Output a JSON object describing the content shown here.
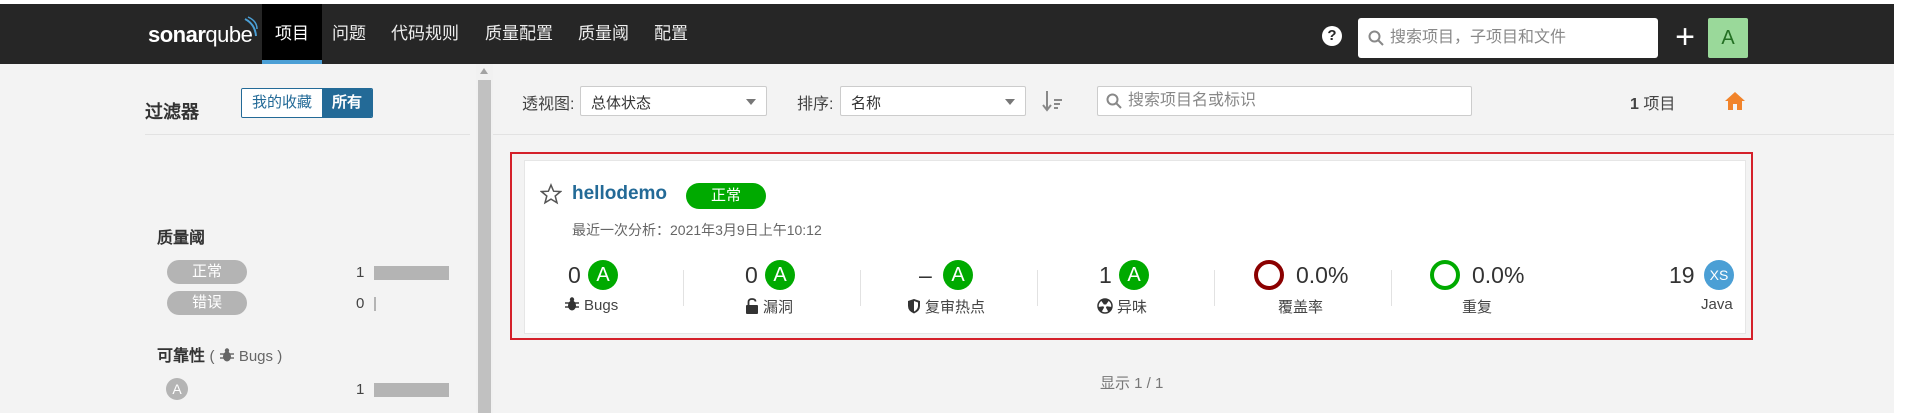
{
  "app": {
    "logo_main": "sonar",
    "logo_lite": "qube"
  },
  "nav": {
    "items": [
      "项目",
      "问题",
      "代码规则",
      "质量配置",
      "质量阈",
      "配置"
    ],
    "active": "项目",
    "search_placeholder": "搜索项目，子项目和文件",
    "help_label": "?",
    "add_label": "+",
    "avatar_letter": "A"
  },
  "sidebar": {
    "toggle": {
      "favorites": "我的收藏",
      "all": "所有"
    },
    "filter_title": "过滤器",
    "quality_gate": {
      "title": "质量阈",
      "items": [
        {
          "label": "正常",
          "count": "1",
          "fraction": 1.0
        },
        {
          "label": "错误",
          "count": "0",
          "fraction": 0.0
        }
      ]
    },
    "reliability": {
      "title": "可靠性",
      "paren_open": "(",
      "sub": "Bugs",
      "paren_close": ")",
      "items": [
        {
          "label": "A",
          "count": "1",
          "fraction": 1.0
        }
      ]
    }
  },
  "toolbar": {
    "perspective_label": "透视图:",
    "perspective_value": "总体状态",
    "sort_label": "排序:",
    "sort_value": "名称",
    "search_placeholder": "搜索项目名或标识",
    "project_count": "1",
    "project_count_suffix": "项目"
  },
  "project": {
    "name": "hellodemo",
    "quality_gate": "正常",
    "last_analysis": "最近一次分析：2021年3月9日上午10:12",
    "measures": [
      {
        "value": "0",
        "grade": "A",
        "label": "Bugs",
        "icon": "bug-icon"
      },
      {
        "value": "0",
        "grade": "A",
        "label": "漏洞",
        "icon": "lock-icon"
      },
      {
        "value": "–",
        "grade": "A",
        "label": "复审热点",
        "icon": "shield-icon"
      },
      {
        "value": "1",
        "grade": "A",
        "label": "异味",
        "icon": "radiation-icon"
      }
    ],
    "coverage": {
      "value": "0.0%",
      "label": "覆盖率",
      "color": "#8b0000"
    },
    "duplications": {
      "value": "0.0%",
      "label": "重复",
      "color": "#00aa00"
    },
    "size": {
      "value": "19",
      "badge": "XS",
      "label": "Java"
    }
  },
  "pagination": "显示 1 / 1",
  "colors": {
    "topbar": "#262626",
    "accent": "#236a97",
    "passed": "#00aa00",
    "highlight": "#d4202a",
    "home": "#f1832a"
  }
}
